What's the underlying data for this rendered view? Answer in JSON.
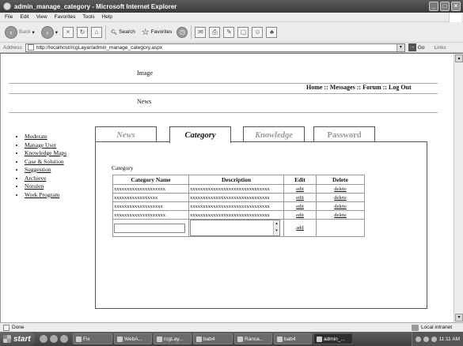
{
  "window": {
    "title": "admin_manage_category - Microsoft Internet Explorer"
  },
  "menu": [
    "File",
    "Edit",
    "View",
    "Favorites",
    "Tools",
    "Help"
  ],
  "toolbar": {
    "back": "Back",
    "search": "Search",
    "favorites": "Favorites"
  },
  "address": {
    "label": "Address",
    "url": "http://localhost/rcgLayar/admin_manage_category.aspx",
    "go": "Go",
    "links": "Links"
  },
  "page": {
    "image_label": "Image",
    "news_label": "News",
    "topnav": {
      "home": "Home",
      "messages": "Messages",
      "forum": "Forum",
      "logout": "Log Out",
      "sep": " :: "
    },
    "sidenav": [
      "Moderate",
      "Manage User",
      "Knowledge Maps",
      "Case & Solution",
      "Suggestion",
      "Archieve",
      "Notulen",
      "Work Program"
    ],
    "tabs": {
      "news": "News",
      "category": "Category",
      "knowledge": "Knowledge",
      "password": "Password"
    },
    "panel_title": "Category",
    "table": {
      "headers": [
        "Category Name",
        "Description",
        "Edit",
        "Delete"
      ],
      "rows": [
        {
          "name": "xxxxxxxxxxxxxxxxxxxx",
          "desc": "xxxxxxxxxxxxxxxxxxxxxxxxxxxxxxx",
          "edit": "edit",
          "delete": "delete"
        },
        {
          "name": "xxxxxxxxxxxxxxxxx",
          "desc": "xxxxxxxxxxxxxxxxxxxxxxxxxxxxxxx",
          "edit": "edit",
          "delete": "delete"
        },
        {
          "name": "xxxxxxxxxxxxxxxxxxx",
          "desc": "xxxxxxxxxxxxxxxxxxxxxxxxxxxxxxx",
          "edit": "edit",
          "delete": "delete"
        },
        {
          "name": "xxxxxxxxxxxxxxxxxxxx",
          "desc": "xxxxxxxxxxxxxxxxxxxxxxxxxxxxxxx",
          "edit": "edit",
          "delete": "delete"
        }
      ],
      "add_label": "add"
    }
  },
  "status": {
    "text": "Done",
    "zone": "Local intranet"
  },
  "taskbar": {
    "start": "start",
    "tasks": [
      "Fix",
      "WebA...",
      "rcgLay...",
      "bab4",
      "Ranca...",
      "bab4",
      "admin_..."
    ],
    "clock": "11:11 AM"
  }
}
